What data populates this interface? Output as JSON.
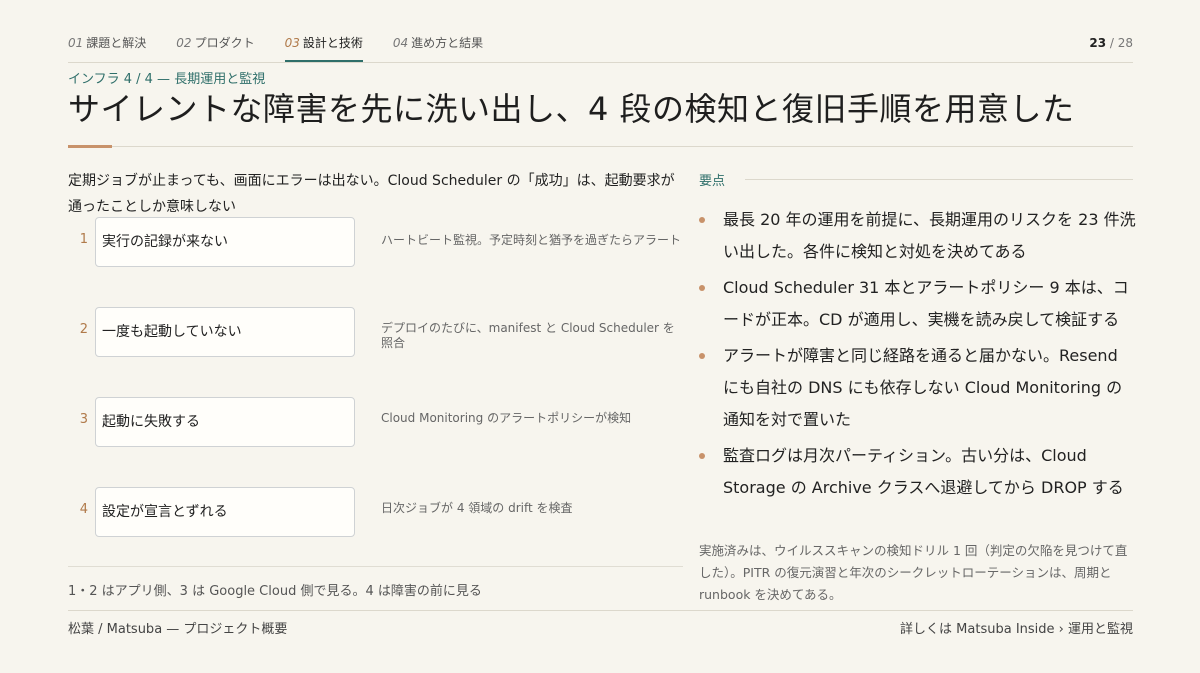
{
  "nav": {
    "items": [
      {
        "num": "01",
        "label": "課題と解決"
      },
      {
        "num": "02",
        "label": "プロダクト"
      },
      {
        "num": "03",
        "label": "設計と技術"
      },
      {
        "num": "04",
        "label": "進め方と結果"
      }
    ],
    "active_index": 2,
    "page_current": "23",
    "page_sep": " / ",
    "page_total": "28"
  },
  "header": {
    "kicker": "インフラ 4 / 4 — 長期運用と監視",
    "title": "サイレントな障害を先に洗い出し、4 段の検知と復旧手順を用意した"
  },
  "left": {
    "lead": "定期ジョブが止まっても、画面にエラーは出ない。Cloud Scheduler の「成功」は、起動要求が通ったことしか意味しない",
    "steps": [
      {
        "num": "1",
        "label": "実行の記録が来ない",
        "desc": "ハートビート監視。予定時刻と猶予を過ぎたらアラート"
      },
      {
        "num": "2",
        "label": "一度も起動していない",
        "desc": "デプロイのたびに、manifest と Cloud Scheduler を照合"
      },
      {
        "num": "3",
        "label": "起動に失敗する",
        "desc": "Cloud Monitoring のアラートポリシーが検知"
      },
      {
        "num": "4",
        "label": "設定が宣言とずれる",
        "desc": "日次ジョブが 4 領域の drift を検査"
      }
    ],
    "note": "1・2 はアプリ側、3 は Google Cloud 側で見る。4 は障害の前に見る"
  },
  "right": {
    "label": "要点",
    "points": [
      "最長 20 年の運用を前提に、長期運用のリスクを 23 件洗い出した。各件に検知と対処を決めてある",
      "Cloud Scheduler 31 本とアラートポリシー 9 本は、コードが正本。CD が適用し、実機を読み戻して検証する",
      "アラートが障害と同じ経路を通ると届かない。Resend にも自社の DNS にも依存しない Cloud Monitoring の通知を対で置いた",
      "監査ログは月次パーティション。古い分は、Cloud Storage の Archive クラスへ退避してから DROP する"
    ],
    "note": "実施済みは、ウイルススキャンの検知ドリル 1 回（判定の欠陥を見つけて直した）。PITR の復元演習と年次のシークレットローテーションは、周期と runbook を決めてある。"
  },
  "footer": {
    "left": "松葉 / Matsuba — プロジェクト概要",
    "right": "詳しくは Matsuba Inside › 運用と監視"
  }
}
